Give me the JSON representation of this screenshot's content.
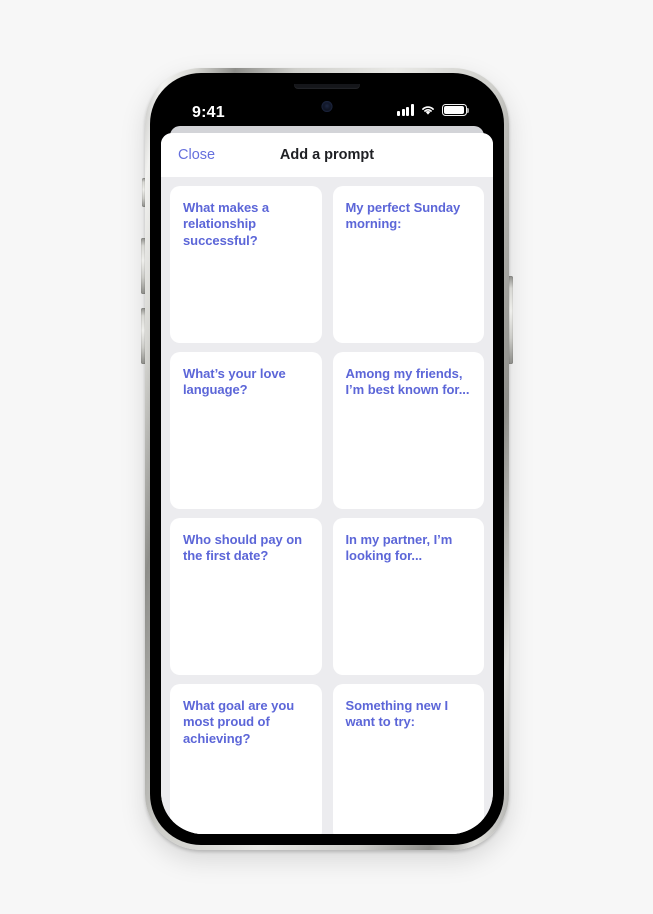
{
  "device": {
    "status_bar": {
      "time": "9:41",
      "cellular_icon": "cellular-bars-icon",
      "wifi_icon": "wifi-icon",
      "battery_icon": "battery-icon",
      "battery_level": "100"
    },
    "buttons": {
      "mute_switch": "mute-switch",
      "volume_up": "volume-up-button",
      "volume_down": "volume-down-button",
      "power": "power-button"
    }
  },
  "sheet": {
    "nav": {
      "close_label": "Close",
      "title": "Add a prompt"
    },
    "prompts": [
      {
        "text": "What makes a relationship successful?"
      },
      {
        "text": "My perfect Sunday morning:"
      },
      {
        "text": "What’s your love language?"
      },
      {
        "text": "Among my friends, I’m best known for..."
      },
      {
        "text": "Who should pay on the first date?"
      },
      {
        "text": "In my partner, I’m looking for..."
      },
      {
        "text": "What goal are you most proud of achieving?"
      },
      {
        "text": "Something new I want to try:"
      }
    ]
  },
  "colors": {
    "page_background": "#f7f7f7",
    "sheet_background": "#ececef",
    "card_background": "#ffffff",
    "prompt_text": "#5c66d8",
    "accent_link": "#6670dd",
    "title_text": "#1f2024"
  }
}
